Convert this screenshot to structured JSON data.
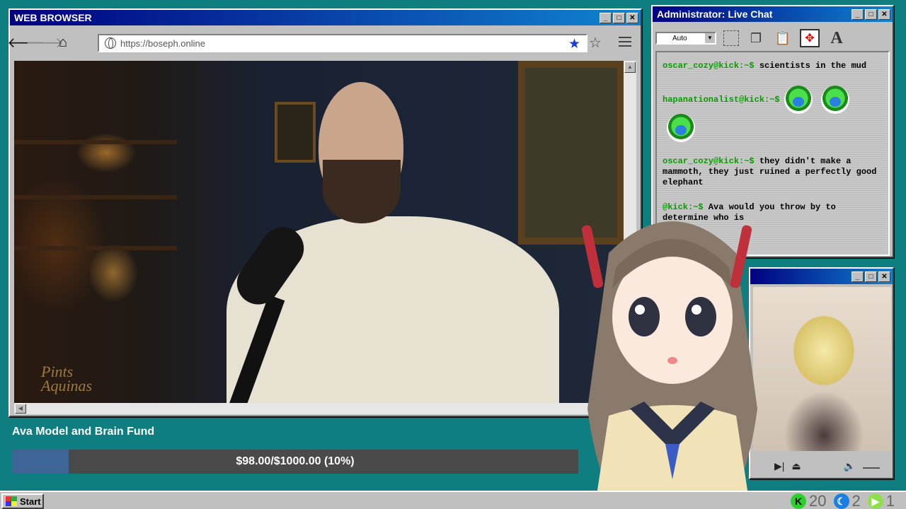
{
  "browser": {
    "title": "WEB BROWSER",
    "url": "https://boseph.online",
    "video_watermark": "Pints with Aquinas"
  },
  "fund": {
    "title": "Ava Model and Brain Fund",
    "raised": 98.0,
    "goal": 1000.0,
    "percent": 10,
    "label": "$98.00/$1000.00 (10%)"
  },
  "chat": {
    "title": "Administrator: Live Chat",
    "zoom_select": "Auto",
    "messages": [
      {
        "user": "oscar_cozy@kick:~$",
        "text": "scientists in the mud",
        "emotes": 0
      },
      {
        "user": "hapanationalist@kick:~$",
        "text": "",
        "emotes": 3
      },
      {
        "user": "oscar_cozy@kick:~$",
        "text": "they didn't make a mammoth, they just ruined a perfectly good elephant",
        "emotes": 0
      },
      {
        "user": "@kick:~$",
        "text": "Ava would you throw by to determine who is",
        "emotes": 0
      }
    ]
  },
  "taskbar": {
    "start_label": "Start",
    "kick_count": "20",
    "moon_count": "2",
    "play_count": "1"
  },
  "colors": {
    "desktop": "#0f7e80",
    "titlebar": "#000080",
    "chat_user": "#0a9a00",
    "fund_fill": "#3d6596"
  }
}
